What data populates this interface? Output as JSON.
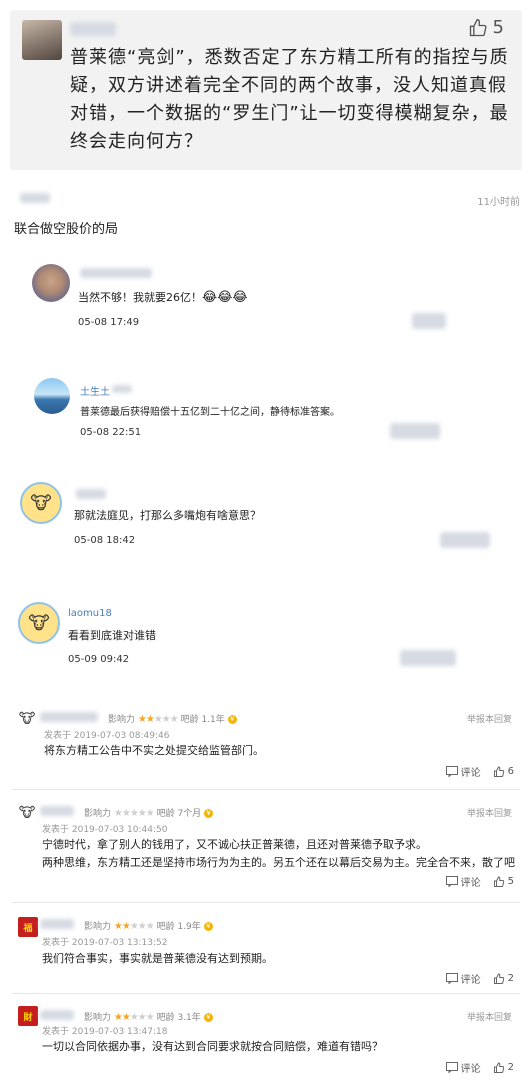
{
  "post": {
    "like_count": "5",
    "text": "普莱德“亮剑”，悉数否定了东方精工所有的指控与质疑，双方讲述着完全不同的两个故事，没人知道真假对错，一个数据的“罗生门”让一切变得模糊复杂，最终会走向何方？"
  },
  "reply": {
    "time": "11小时前",
    "text": "联合做空股价的局"
  },
  "comments": [
    {
      "name": "",
      "text": "当然不够！我就要26亿！",
      "emoji": "😂😂😂",
      "time": "05-08 17:49"
    },
    {
      "name": "土生土",
      "text": "普莱德最后获得赔偿十五亿到二十亿之间，静待标准答案。",
      "time": "05-08 22:51"
    },
    {
      "name": "",
      "text": "那就法庭见，打那么多嘴炮有啥意思？",
      "time": "05-08 18:42"
    },
    {
      "name": "laomu18",
      "text": "看看到底谁对谁错",
      "time": "05-09 09:42"
    }
  ],
  "reviews": [
    {
      "influence_label": "影响力",
      "stars_on": "★★",
      "stars_off": "★★★",
      "age_label": "吧龄 1.1年",
      "report": "举报本回复",
      "date": "发表于 2019-07-03 08:49:46",
      "lines": [
        "将东方精工公告中不实之处提交给监管部门。"
      ],
      "comment_label": "评论",
      "likes": "6"
    },
    {
      "influence_label": "影响力",
      "stars_on": "",
      "stars_off": "★★★★★",
      "age_label": "吧龄 7个月",
      "report": "举报本回复",
      "date": "发表于 2019-07-03 10:44:50",
      "lines": [
        "宁德时代，拿了别人的钱用了，又不诚心扶正普莱德，且还对普莱德予取予求。",
        "两种思维，东方精工还是坚持市场行为为主的。另五个还在以幕后交易为主。完全合不来，散了吧"
      ],
      "comment_label": "评论",
      "likes": "5"
    },
    {
      "influence_label": "影响力",
      "stars_on": "★★",
      "stars_off": "★★★",
      "age_label": "吧龄 1.9年",
      "report": "",
      "date": "发表于 2019-07-03 13:13:52",
      "lines": [
        "我们符合事实，事实就是普莱德没有达到预期。"
      ],
      "comment_label": "评论",
      "likes": "2"
    },
    {
      "influence_label": "影响力",
      "stars_on": "★★",
      "stars_off": "★★★",
      "age_label": "吧龄 3.1年",
      "report": "举报本回复",
      "date": "发表于 2019-07-03 13:47:18",
      "lines": [
        "一切以合同依据办事，没有达到合同要求就按合同赔偿，难道有错吗？"
      ],
      "comment_label": "评论",
      "likes": "2"
    }
  ],
  "icons": {
    "like": "thumbs-up-icon",
    "comment": "comment-icon",
    "cow": "cow-avatar-icon"
  }
}
